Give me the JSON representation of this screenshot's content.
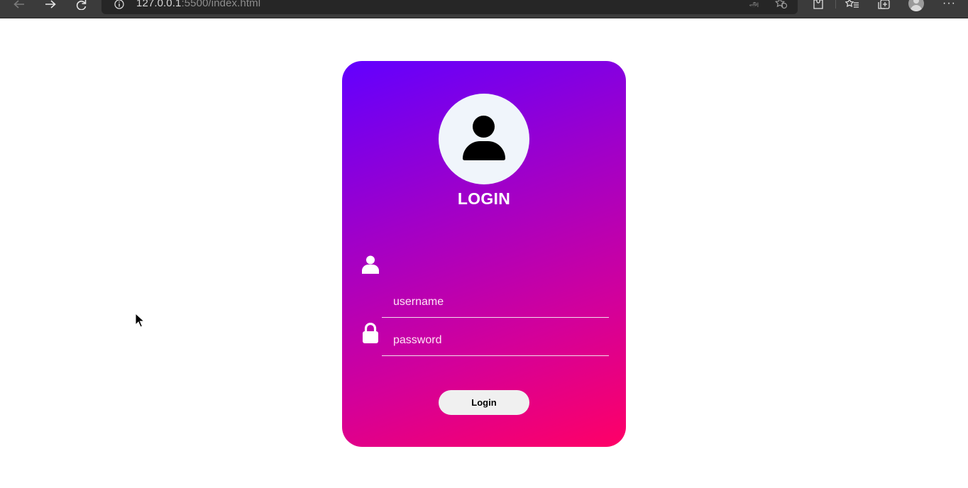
{
  "browser": {
    "url_host": "127.0.0.1",
    "url_rest": ":5500/index.html",
    "read_aloud_glyph": "அ"
  },
  "icons": [
    "back-icon",
    "forward-icon",
    "refresh-icon",
    "info-icon",
    "favorites-add-icon",
    "extensions-icon",
    "favorites-icon",
    "collections-icon",
    "profile-icon",
    "more-icon",
    "user-icon",
    "lock-icon",
    "mouse-cursor-icon"
  ],
  "colors": {
    "gradient_start": "#6200ff",
    "gradient_end": "#ff0066",
    "avatar_bg": "#f0f5fb",
    "button_bg": "#f0f0f0"
  },
  "login": {
    "title": "LOGIN",
    "username_placeholder": "username",
    "password_placeholder": "password",
    "button_label": "Login"
  }
}
